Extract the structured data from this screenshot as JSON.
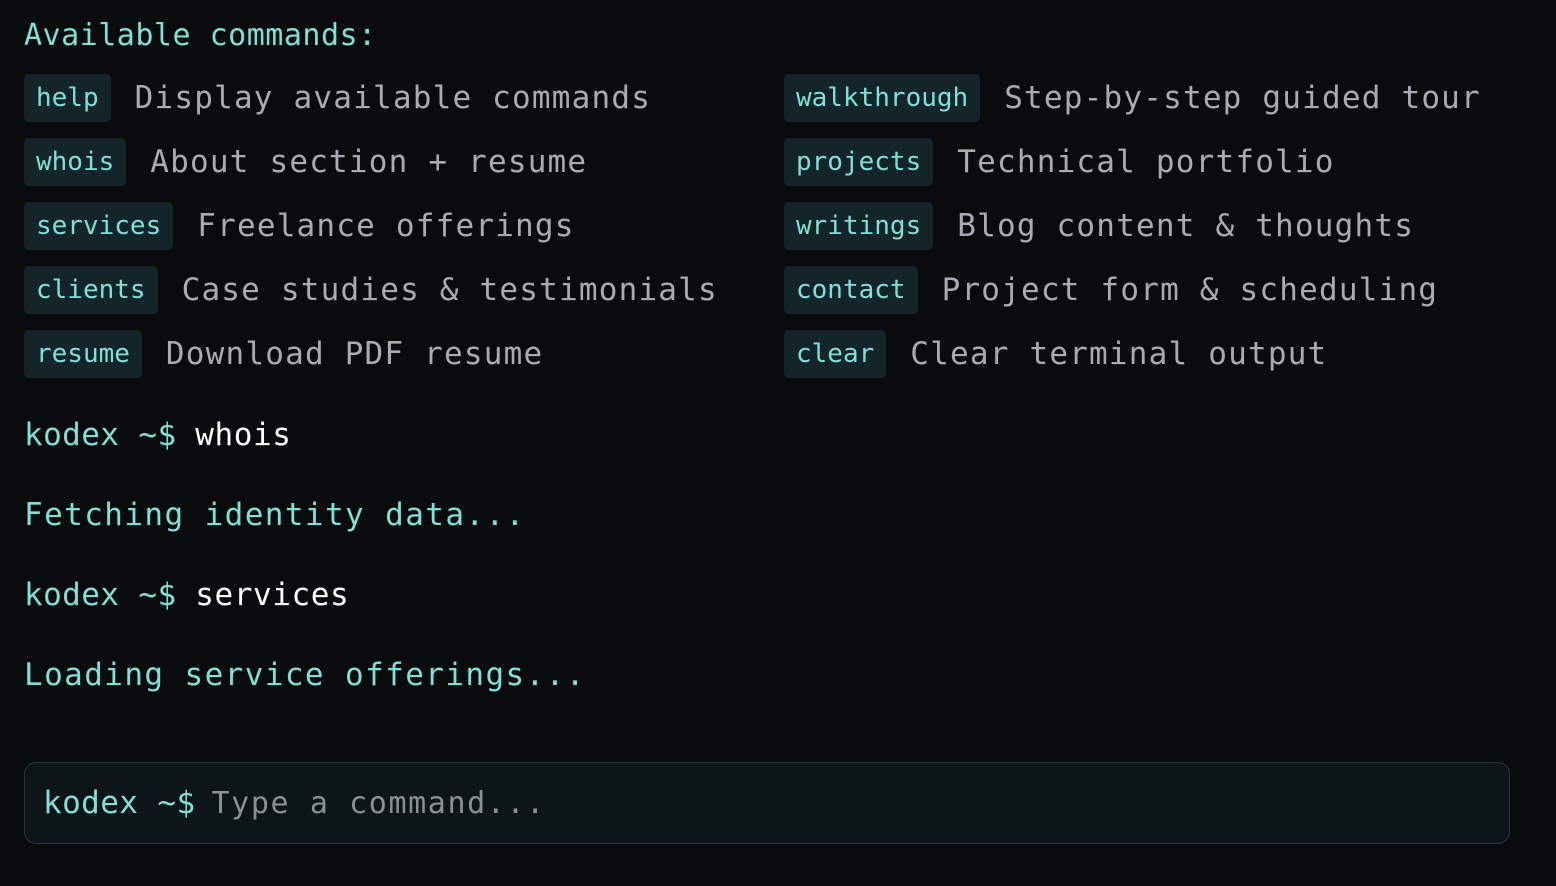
{
  "help_section": {
    "heading": "Available commands:",
    "commands_left": [
      {
        "name": "help",
        "description": "Display available commands"
      },
      {
        "name": "whois",
        "description": "About section + resume"
      },
      {
        "name": "services",
        "description": "Freelance offerings"
      },
      {
        "name": "clients",
        "description": "Case studies & testimonials"
      },
      {
        "name": "resume",
        "description": "Download PDF resume"
      }
    ],
    "commands_right": [
      {
        "name": "walkthrough",
        "description": "Step-by-step guided tour"
      },
      {
        "name": "projects",
        "description": "Technical portfolio"
      },
      {
        "name": "writings",
        "description": "Blog content & thoughts"
      },
      {
        "name": "contact",
        "description": "Project form & scheduling"
      },
      {
        "name": "clear",
        "description": "Clear terminal output"
      }
    ]
  },
  "history": [
    {
      "prompt": "kodex ~$",
      "command": "whois",
      "output": "Fetching identity data..."
    },
    {
      "prompt": "kodex ~$",
      "command": "services",
      "output": "Loading service offerings..."
    }
  ],
  "input": {
    "prompt": "kodex ~$",
    "placeholder": "Type a command..."
  },
  "colors": {
    "background": "#0a0b0d",
    "accent": "#7fe0d8",
    "tag_bg": "#13252a",
    "muted_text": "#a7acb2"
  }
}
